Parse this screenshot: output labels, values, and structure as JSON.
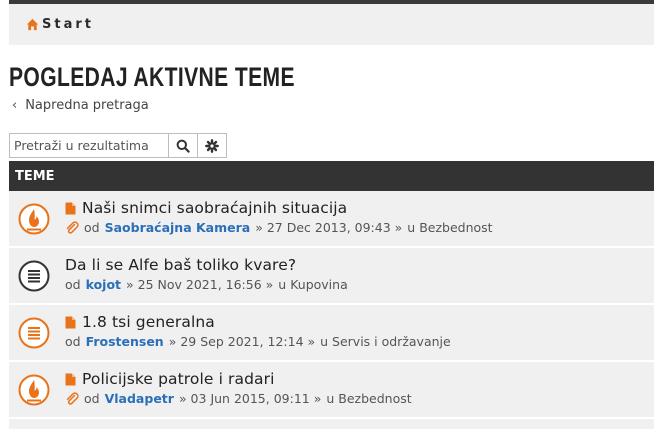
{
  "nav": {
    "start_label": "Start"
  },
  "page_title": "POGLEDAJ AKTIVNE TEME",
  "advanced_search_label": "Napredna pretraga",
  "search": {
    "placeholder": "Pretraži u rezultatima"
  },
  "table": {
    "header": "TEME"
  },
  "topics": [
    {
      "title": "Naši snimci saobraćajnih situacija",
      "by": "od",
      "author": "Saobraćajna Kamera",
      "date": "» 27 Dec 2013, 09:43 »",
      "forum": "u Bezbednost",
      "has_attachment": true,
      "has_file_icon": true,
      "icon": "hot-topic-icon"
    },
    {
      "title": "Da li se Alfe baš toliko kvare?",
      "by": "od",
      "author": "kojot",
      "date": "» 25 Nov 2021, 16:56 »",
      "forum": "u Kupovina",
      "has_attachment": false,
      "has_file_icon": false,
      "icon": "read-topic-icon"
    },
    {
      "title": "1.8 tsi generalna",
      "by": "od",
      "author": "Frostensen",
      "date": "» 29 Sep 2021, 12:14 »",
      "forum": "u Servis i održavanje",
      "has_attachment": false,
      "has_file_icon": true,
      "icon": "unread-topic-icon"
    },
    {
      "title": "Policijske patrole i radari",
      "by": "od",
      "author": "Vladapetr",
      "date": "» 03 Jun 2015, 09:11 »",
      "forum": "u Bezbednost",
      "has_attachment": true,
      "has_file_icon": true,
      "icon": "hot-topic-icon"
    }
  ],
  "colors": {
    "accent": "#e8731a",
    "author_link": "#2a6fb8",
    "header_bg": "#333333",
    "row_bg": "#f0f0f0"
  }
}
